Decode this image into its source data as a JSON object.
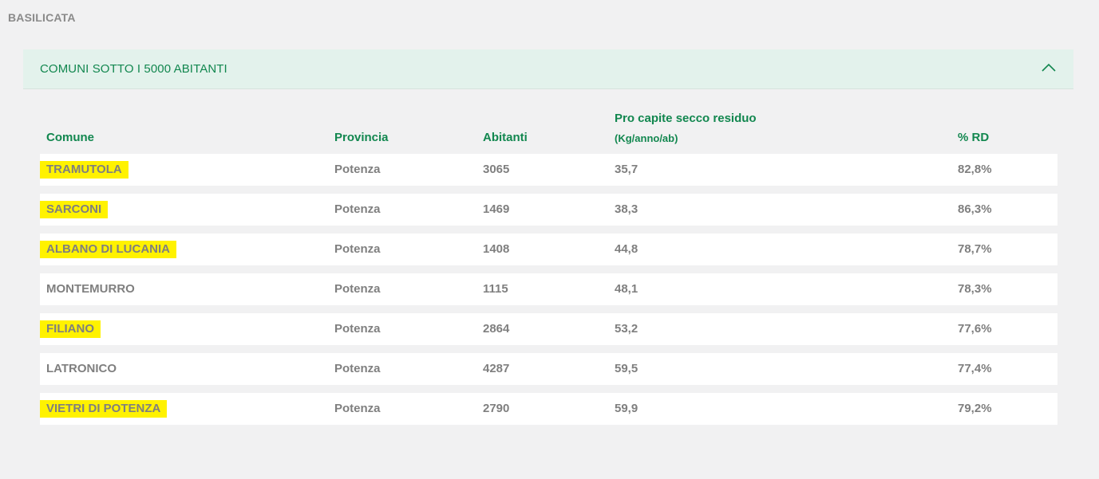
{
  "region": "BASILICATA",
  "accordion": {
    "title": "COMUNI SOTTO I 5000 ABITANTI",
    "toggle_icon": "chevron-up-icon",
    "accent_color": "#12874f"
  },
  "table": {
    "headers": {
      "comune": "Comune",
      "provincia": "Provincia",
      "abitanti": "Abitanti",
      "pro_capite": "Pro capite secco residuo",
      "pro_capite_unit": "(Kg/anno/ab)",
      "rd": "% RD"
    },
    "highlight_color": "#fff200",
    "rows": [
      {
        "comune": "TRAMUTOLA",
        "provincia": "Potenza",
        "abitanti": "3065",
        "pro_capite": "35,7",
        "rd": "82,8%",
        "highlighted": true
      },
      {
        "comune": "SARCONI",
        "provincia": "Potenza",
        "abitanti": "1469",
        "pro_capite": "38,3",
        "rd": "86,3%",
        "highlighted": true
      },
      {
        "comune": "ALBANO DI LUCANIA",
        "provincia": "Potenza",
        "abitanti": "1408",
        "pro_capite": "44,8",
        "rd": "78,7%",
        "highlighted": true
      },
      {
        "comune": "MONTEMURRO",
        "provincia": "Potenza",
        "abitanti": "1115",
        "pro_capite": "48,1",
        "rd": "78,3%",
        "highlighted": false
      },
      {
        "comune": "FILIANO",
        "provincia": "Potenza",
        "abitanti": "2864",
        "pro_capite": "53,2",
        "rd": "77,6%",
        "highlighted": true
      },
      {
        "comune": "LATRONICO",
        "provincia": "Potenza",
        "abitanti": "4287",
        "pro_capite": "59,5",
        "rd": "77,4%",
        "highlighted": false
      },
      {
        "comune": "VIETRI DI POTENZA",
        "provincia": "Potenza",
        "abitanti": "2790",
        "pro_capite": "59,9",
        "rd": "79,2%",
        "highlighted": true
      }
    ]
  }
}
